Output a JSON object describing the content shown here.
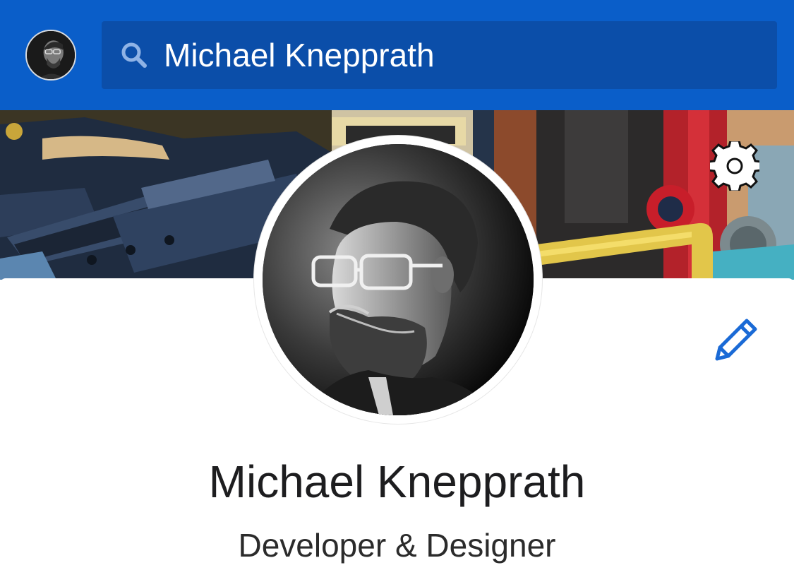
{
  "header": {
    "search": {
      "value": "Michael Knepprath",
      "icon": "search-icon"
    },
    "account_avatar_icon": "avatar"
  },
  "cover": {
    "settings_icon": "gear-icon"
  },
  "profile": {
    "name": "Michael Knepprath",
    "tagline": "Developer & Designer",
    "edit_icon": "pencil-icon"
  },
  "colors": {
    "brand_blue": "#0a5ec9",
    "search_bg": "#0b4ea9",
    "accent_blue": "#1a6ad6"
  }
}
